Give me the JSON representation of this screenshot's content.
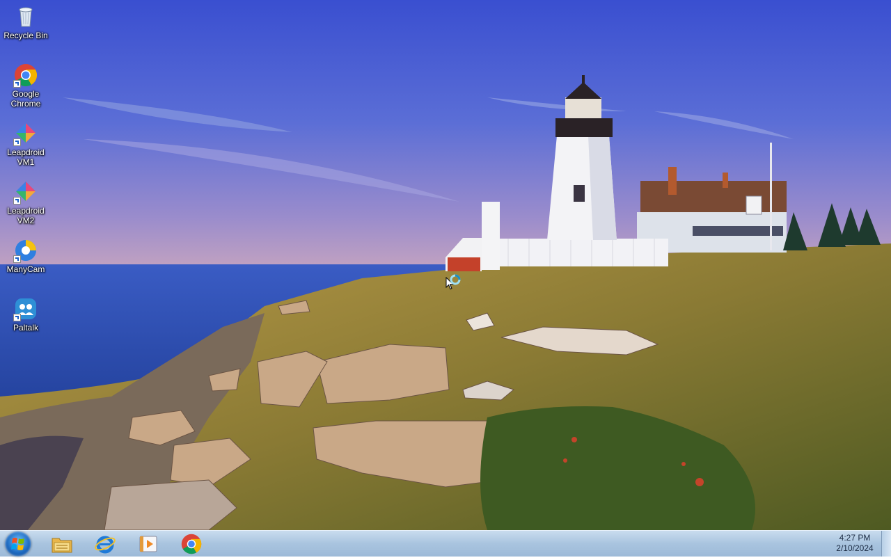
{
  "desktop_icons": [
    {
      "label": "Recycle Bin",
      "icon": "recycle-bin-icon"
    },
    {
      "label": "Google\nChrome",
      "icon": "chrome-icon"
    },
    {
      "label": "Leapdroid\nVM1",
      "icon": "leapdroid-icon"
    },
    {
      "label": "Leapdroid\nVM2",
      "icon": "leapdroid-icon"
    },
    {
      "label": "ManyCam",
      "icon": "manycam-icon"
    },
    {
      "label": "Paltalk",
      "icon": "paltalk-icon"
    }
  ],
  "taskbar": {
    "start_icon": "windows-logo-icon",
    "pinned": [
      {
        "name": "Windows Explorer",
        "icon": "folder-icon"
      },
      {
        "name": "Internet Explorer",
        "icon": "internet-explorer-icon"
      },
      {
        "name": "Windows Media Player",
        "icon": "media-player-icon"
      },
      {
        "name": "Google Chrome",
        "icon": "chrome-icon"
      }
    ]
  },
  "clock": {
    "time": "4:27 PM",
    "date": "2/10/2024"
  },
  "colors": {
    "taskbar": "#a9c4df",
    "sky_top": "#3e56d6",
    "sea": "#2f52b8",
    "grass": "#a48a3a"
  }
}
